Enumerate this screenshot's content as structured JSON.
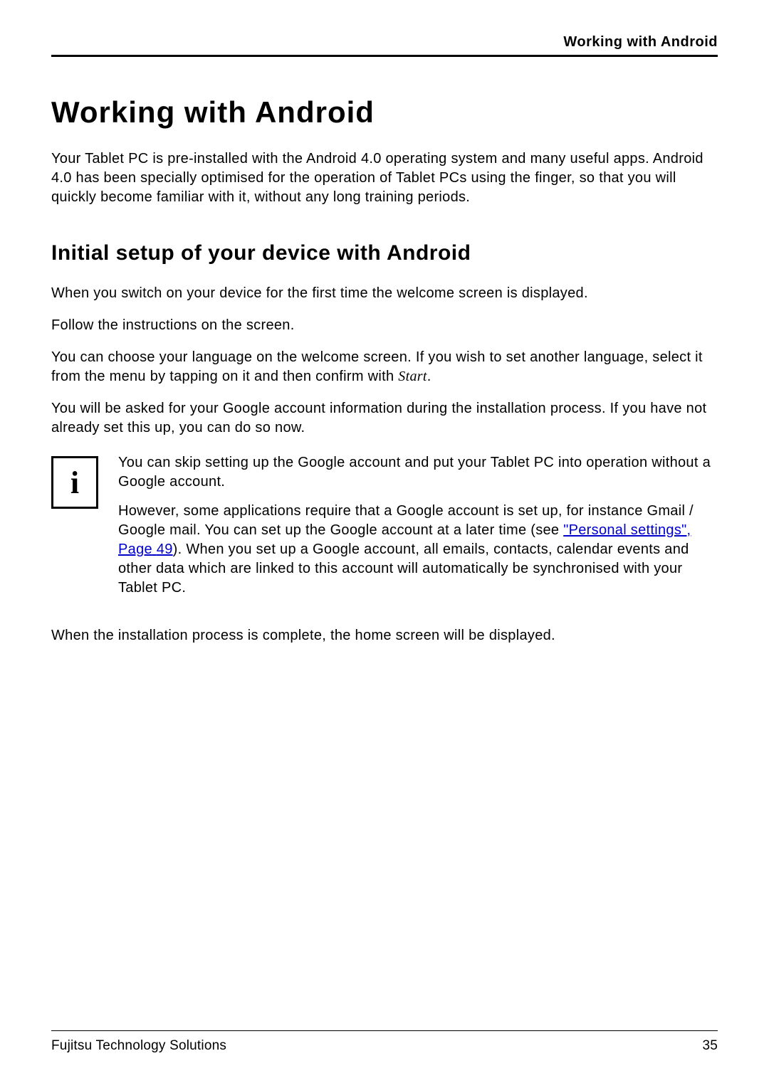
{
  "header": {
    "running_title": "Working with Android"
  },
  "title": "Working with Android",
  "intro": "Your Tablet PC is pre-installed with the Android 4.0 operating system and many useful apps. Android 4.0 has been specially optimised for the operation of Tablet PCs using the finger, so that you will quickly become familiar with it, without any long training periods.",
  "section": {
    "heading": "Initial setup of your device with Android",
    "p1": "When you switch on your device for the first time the welcome screen is displayed.",
    "p2": "Follow the instructions on the screen.",
    "p3_pre": "You can choose your language on the welcome screen. If you wish to set another language, select it from the menu by tapping on it and then confirm with ",
    "p3_start": "Start",
    "p3_post": ".",
    "p4": "You will be asked for your Google account information during the installation process. If you have not already set this up, you can do so now."
  },
  "info": {
    "icon_glyph": "i",
    "p1": "You can skip setting up the Google account and put your Tablet PC into operation without a Google account.",
    "p2_pre": "However, some applications require that a Google account is set up, for instance Gmail / Google mail. You can set up the Google account at a later time (see ",
    "p2_link_text": "\"Personal settings\", Page",
    "p2_link_page": "49",
    "p2_post": "). When you set up a Google account, all emails, contacts, calendar events and other data which are linked to this account will automatically be synchronised with your Tablet PC."
  },
  "after_info": "When the installation process is complete, the home screen will be displayed.",
  "footer": {
    "left": "Fujitsu Technology Solutions",
    "page_number": "35"
  }
}
